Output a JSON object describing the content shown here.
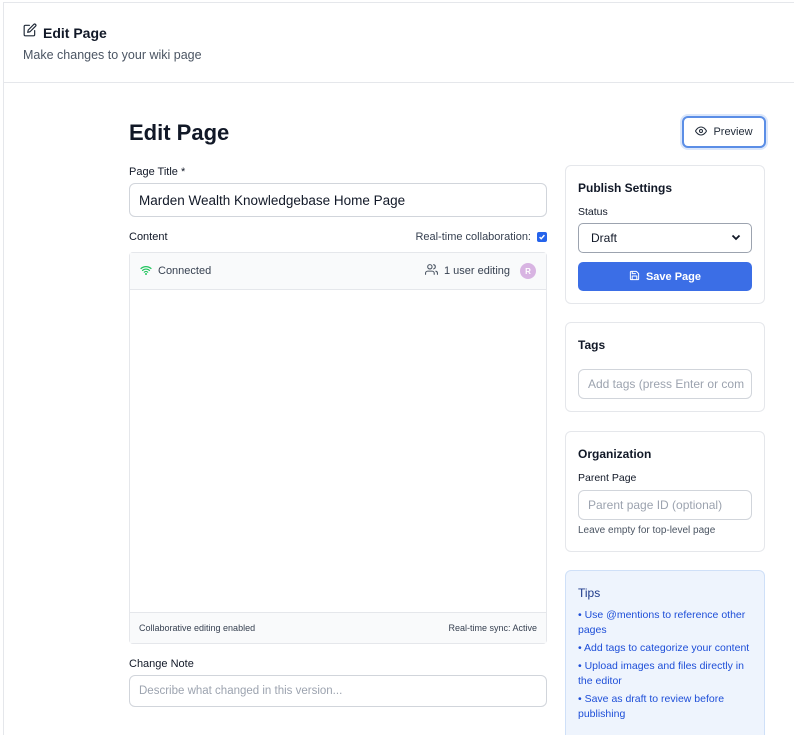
{
  "header": {
    "title": "Edit Page",
    "subtitle": "Make changes to your wiki page"
  },
  "main": {
    "heading": "Edit Page",
    "preview_label": "Preview",
    "title_label": "Page Title *",
    "title_value": "Marden Wealth Knowledgebase Home Page",
    "content_label": "Content",
    "collab_label": "Real-time collaboration:",
    "collab_checked": true,
    "editor": {
      "status": "Connected",
      "users": "1 user editing",
      "avatar_initial": "R",
      "footer_left": "Collaborative editing enabled",
      "footer_right": "Real-time sync: Active"
    },
    "change_note_label": "Change Note",
    "change_note_placeholder": "Describe what changed in this version..."
  },
  "publish": {
    "title": "Publish Settings",
    "status_label": "Status",
    "status_value": "Draft",
    "save_label": "Save Page"
  },
  "tags": {
    "title": "Tags",
    "placeholder": "Add tags (press Enter or com"
  },
  "organization": {
    "title": "Organization",
    "parent_label": "Parent Page",
    "parent_placeholder": "Parent page ID (optional)",
    "hint": "Leave empty for top-level page"
  },
  "tips": {
    "title": "Tips",
    "items": [
      "• Use @mentions to reference other pages",
      "• Add tags to categorize your content",
      "• Upload images and files directly in the editor",
      "• Save as draft to review before publishing"
    ]
  },
  "colors": {
    "accent": "#3b6ee6",
    "tips_bg": "#eef4fd",
    "connected": "#22c55e"
  }
}
